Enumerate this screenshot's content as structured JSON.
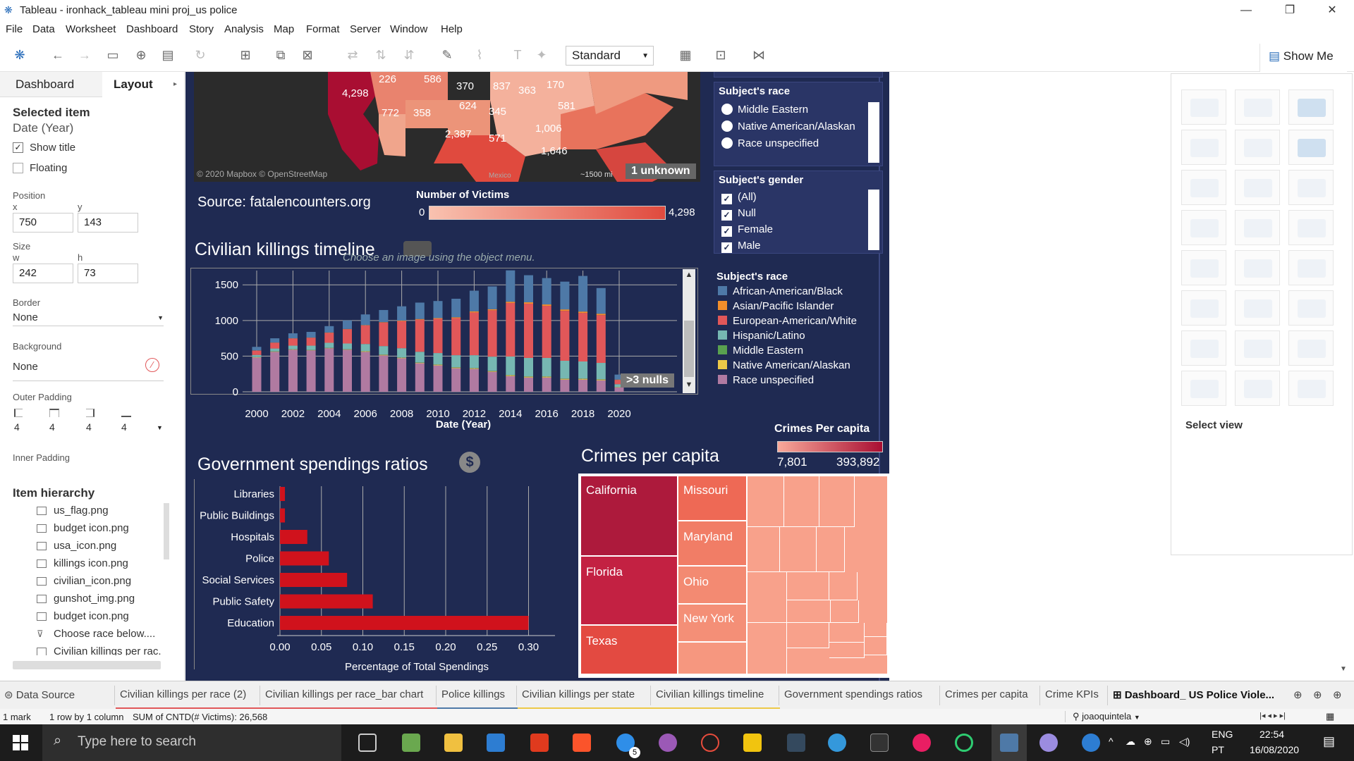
{
  "window": {
    "title": "Tableau - ironhack_tableau mini proj_us police"
  },
  "menu": [
    "File",
    "Data",
    "Worksheet",
    "Dashboard",
    "Story",
    "Analysis",
    "Map",
    "Format",
    "Server",
    "Window",
    "Help"
  ],
  "toolbar": {
    "fit_select": "Standard",
    "show_me": "Show Me"
  },
  "left_panel": {
    "tabs": [
      "Dashboard",
      "Layout"
    ],
    "selected_item_heading": "Selected item",
    "selected_item": "Date (Year)",
    "show_title": "Show title",
    "floating": "Floating",
    "position_label": "Position",
    "x_label": "x",
    "y_label": "y",
    "x": "750",
    "y": "143",
    "size_label": "Size",
    "w_label": "w",
    "h_label": "h",
    "w": "242",
    "h": "73",
    "border_label": "Border",
    "border": "None",
    "background_label": "Background",
    "background": "None",
    "outer_padding_label": "Outer Padding",
    "outer_padding": [
      "4",
      "4",
      "4",
      "4"
    ],
    "inner_padding_label": "Inner Padding",
    "hierarchy_heading": "Item hierarchy",
    "hierarchy": [
      "us_flag.png",
      "budget icon.png",
      "usa_icon.png",
      "killings icon.png",
      "civilian_icon.png",
      "gunshot_img.png",
      "budget icon.png",
      "Choose race below....",
      "Civilian killings per rac."
    ]
  },
  "map": {
    "labels": [
      "226",
      "586",
      "370",
      "837",
      "363",
      "170",
      "4,298",
      "772",
      "358",
      "624",
      "345",
      "581",
      "2,387",
      "571",
      "1,006",
      "1,646"
    ],
    "copyright": "© 2020 Mapbox © OpenStreetMap",
    "scale": "~1500 mi",
    "unknown": "1 unknown",
    "country": "Mexico",
    "source_prefix": "Source: ",
    "source_site": "fatalencounters.org",
    "legend_title": "Number of Victims",
    "legend_min": "0",
    "legend_max": "4,298"
  },
  "timeline": {
    "title": "Civilian killings timeline",
    "placeholder": "Choose an image using the object menu.",
    "nulls_badge": ">3 nulls",
    "xlabel": "Date (Year)"
  },
  "spending": {
    "title": "Government spendings ratios",
    "xlabel": "Percentage of Total Spendings"
  },
  "crimes": {
    "title": "Crimes per capita",
    "legend_title": "Crimes Per capita",
    "legend_min": "7,801",
    "legend_max": "393,892",
    "states": [
      "California",
      "Missouri",
      "Maryland",
      "Florida",
      "Ohio",
      "New York",
      "Texas"
    ]
  },
  "filters": {
    "race_title": "Subject's race",
    "race_options": [
      "Middle Eastern",
      "Native American/Alaskan",
      "Race unspecified"
    ],
    "gender_title": "Subject's gender",
    "gender_options": [
      "(All)",
      "Null",
      "Female",
      "Male"
    ],
    "legend_title": "Subject's race"
  },
  "race_legend": [
    {
      "name": "African-American/Black",
      "color": "#4e79a7"
    },
    {
      "name": "Asian/Pacific Islander",
      "color": "#f28e2b"
    },
    {
      "name": "European-American/White",
      "color": "#e15759"
    },
    {
      "name": "Hispanic/Latino",
      "color": "#76b7b2"
    },
    {
      "name": "Middle Eastern",
      "color": "#59a14f"
    },
    {
      "name": "Native American/Alaskan",
      "color": "#edc948"
    },
    {
      "name": "Race unspecified",
      "color": "#b07aa1"
    }
  ],
  "show_me_panel": {
    "select_view": "Select view"
  },
  "sheet_tabs": [
    {
      "label": "Data Source",
      "color": ""
    },
    {
      "label": "Civilian killings per race (2)",
      "color": "#e15759"
    },
    {
      "label": "Civilian killings per race_bar chart",
      "color": "#e15759"
    },
    {
      "label": "Police killings",
      "color": "#4e79a7"
    },
    {
      "label": "Civilian killings per state",
      "color": "#edc948"
    },
    {
      "label": "Civilian killings timeline",
      "color": "#edc948"
    },
    {
      "label": "Government spendings ratios",
      "color": ""
    },
    {
      "label": "Crimes per capita",
      "color": ""
    },
    {
      "label": "Crime KPIs",
      "color": ""
    },
    {
      "label": "Dashboard_ US Police Viole...",
      "color": ""
    }
  ],
  "status": {
    "marks": "1 mark",
    "rows": "1 row by 1 column",
    "sum": "SUM of CNTD(# Victims): 26,568",
    "user": "joaoquintela"
  },
  "taskbar": {
    "search": "Type here to search",
    "lang1": "ENG",
    "lang2": "PT",
    "time": "22:54",
    "date": "16/08/2020",
    "badge": "5"
  },
  "chart_data": [
    {
      "type": "bar",
      "title": "Civilian killings timeline",
      "xlabel": "Date (Year)",
      "ylabel": "",
      "ylim": [
        0,
        1700
      ],
      "y_ticks": [
        0,
        500,
        1000,
        1500
      ],
      "x_tick_labels": [
        "2000",
        "2002",
        "2004",
        "2006",
        "2008",
        "2010",
        "2012",
        "2014",
        "2016",
        "2018",
        "2020"
      ],
      "categories": [
        "2000",
        "2001",
        "2002",
        "2003",
        "2004",
        "2005",
        "2006",
        "2007",
        "2008",
        "2009",
        "2010",
        "2011",
        "2012",
        "2013",
        "2014",
        "2015",
        "2016",
        "2017",
        "2018",
        "2019",
        "2020"
      ],
      "series": [
        {
          "name": "Race unspecified",
          "values": [
            480,
            560,
            590,
            580,
            610,
            590,
            560,
            510,
            470,
            400,
            370,
            330,
            320,
            280,
            220,
            200,
            200,
            170,
            170,
            160,
            60
          ]
        },
        {
          "name": "Native American/Alaskan",
          "values": [
            5,
            5,
            5,
            5,
            5,
            5,
            8,
            8,
            8,
            8,
            10,
            10,
            10,
            10,
            12,
            12,
            12,
            12,
            12,
            12,
            5
          ]
        },
        {
          "name": "Middle Eastern",
          "values": [
            2,
            2,
            2,
            2,
            2,
            2,
            2,
            3,
            3,
            3,
            3,
            3,
            3,
            3,
            3,
            3,
            3,
            3,
            3,
            3,
            1
          ]
        },
        {
          "name": "Hispanic/Latino",
          "values": [
            30,
            40,
            50,
            60,
            70,
            80,
            100,
            120,
            130,
            150,
            160,
            170,
            180,
            200,
            260,
            260,
            260,
            250,
            240,
            230,
            40
          ]
        },
        {
          "name": "European-American/White",
          "values": [
            60,
            80,
            100,
            110,
            140,
            200,
            260,
            330,
            380,
            450,
            480,
            520,
            600,
            650,
            750,
            760,
            730,
            700,
            680,
            670,
            60
          ]
        },
        {
          "name": "Asian/Pacific Islander",
          "values": [
            3,
            3,
            3,
            3,
            4,
            4,
            5,
            6,
            8,
            10,
            10,
            12,
            15,
            15,
            18,
            20,
            20,
            20,
            20,
            20,
            5
          ]
        },
        {
          "name": "African-American/Black",
          "values": [
            50,
            60,
            70,
            80,
            90,
            120,
            150,
            170,
            200,
            230,
            240,
            260,
            290,
            320,
            440,
            380,
            370,
            390,
            500,
            360,
            70
          ]
        }
      ]
    },
    {
      "type": "bar",
      "orientation": "horizontal",
      "title": "Government spendings ratios",
      "xlabel": "Percentage of Total Spendings",
      "xlim": [
        0,
        0.32
      ],
      "x_tick_labels": [
        "0.00",
        "0.05",
        "0.10",
        "0.15",
        "0.20",
        "0.25",
        "0.30"
      ],
      "categories": [
        "Libraries",
        "Public Buildings",
        "Hospitals",
        "Police",
        "Social Services",
        "Public Safety",
        "Education"
      ],
      "values": [
        0.006,
        0.006,
        0.033,
        0.059,
        0.081,
        0.112,
        0.3
      ]
    },
    {
      "type": "treemap",
      "title": "Crimes per capita",
      "labels": [
        "California",
        "Missouri",
        "Maryland",
        "Florida",
        "Ohio",
        "New York",
        "Texas"
      ],
      "color_range": [
        7801,
        393892
      ]
    }
  ]
}
